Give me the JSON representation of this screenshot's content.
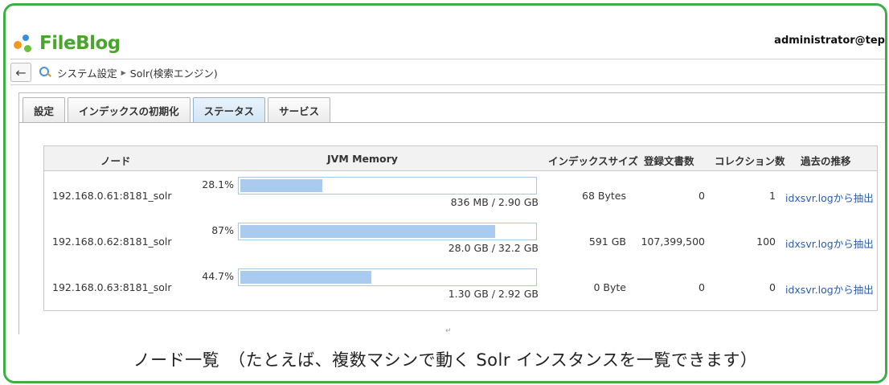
{
  "header": {
    "logo_text": "FileBlog",
    "user": "administrator@tep"
  },
  "breadcrumb": {
    "back_label": "←",
    "items": [
      "システム設定",
      "Solr(検索エンジン)"
    ]
  },
  "tabs": [
    {
      "label": "設定",
      "active": false
    },
    {
      "label": "インデックスの初期化",
      "active": false
    },
    {
      "label": "ステータス",
      "active": true
    },
    {
      "label": "サービス",
      "active": false
    }
  ],
  "table": {
    "columns": [
      "ノード",
      "JVM Memory",
      "インデックスサイズ",
      "登録文書数",
      "コレクション数",
      "過去の推移"
    ],
    "rows": [
      {
        "node": "192.168.0.61:8181_solr",
        "percent_label": "28.1%",
        "percent": 28.1,
        "memory": "836 MB / 2.90 GB",
        "index_size": "68 Bytes",
        "documents": "0",
        "collections": "1",
        "history": "idxsvr.logから抽出"
      },
      {
        "node": "192.168.0.62:8181_solr",
        "percent_label": "87%",
        "percent": 87,
        "memory": "28.0 GB / 32.2 GB",
        "index_size": "591 GB",
        "documents": "107,399,500",
        "collections": "100",
        "history": "idxsvr.logから抽出"
      },
      {
        "node": "192.168.0.63:8181_solr",
        "percent_label": "44.7%",
        "percent": 44.7,
        "memory": "1.30 GB / 2.92 GB",
        "index_size": "0 Byte",
        "documents": "0",
        "collections": "0",
        "history": "idxsvr.logから抽出"
      }
    ]
  },
  "caption": "ノード一覧　（たとえば、複数マシンで動く Solr インスタンスを一覧できます）",
  "colors": {
    "frame": "#3cb043",
    "bar_fill": "#a9cbef",
    "link": "#2a5db0"
  }
}
